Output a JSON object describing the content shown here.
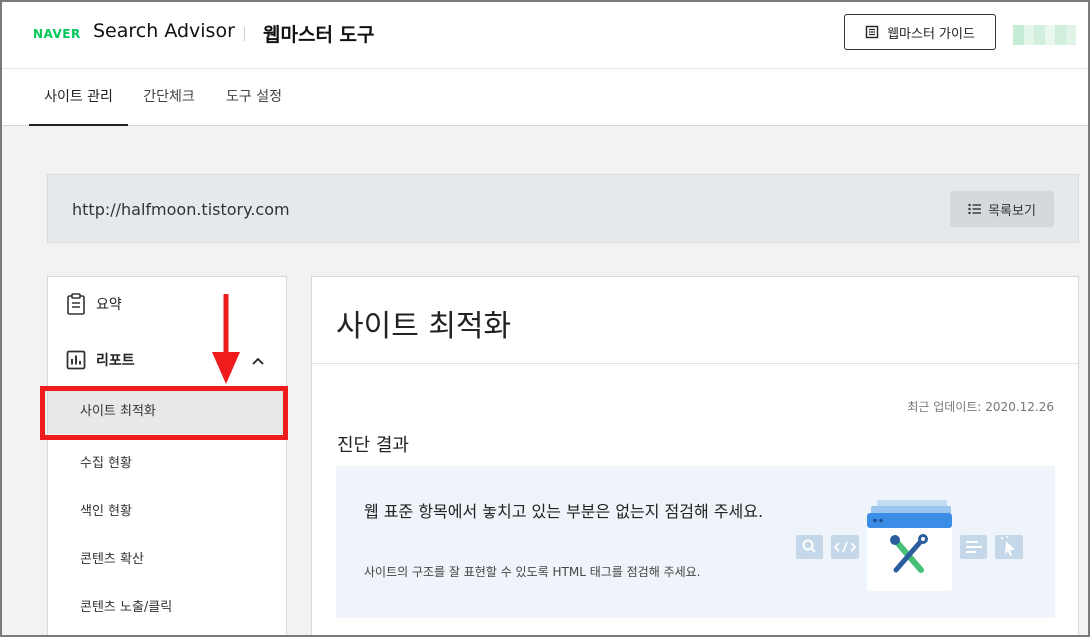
{
  "header": {
    "logo": "NAVER",
    "brand": "Search Advisor",
    "app_title": "웹마스터 도구",
    "guide_button": "웹마스터 가이드"
  },
  "tabs": [
    {
      "label": "사이트 관리",
      "active": true
    },
    {
      "label": "간단체크",
      "active": false
    },
    {
      "label": "도구 설정",
      "active": false
    }
  ],
  "site": {
    "url": "http://halfmoon.tistory.com",
    "list_button": "목록보기"
  },
  "sidebar": {
    "summary": "요약",
    "report": "리포트",
    "items": [
      {
        "label": "사이트 최적화",
        "active": true
      },
      {
        "label": "수집 현황",
        "active": false
      },
      {
        "label": "색인 현황",
        "active": false
      },
      {
        "label": "콘텐츠 확산",
        "active": false
      },
      {
        "label": "콘텐츠 노출/클릭",
        "active": false
      }
    ]
  },
  "main": {
    "title": "사이트 최적화",
    "updated": "최근 업데이트: 2020.12.26",
    "section_title": "진단 결과",
    "card_main": "웹 표준 항목에서 놓치고 있는 부분은 없는지 점검해 주세요.",
    "card_sub": "사이트의 구조를 잘 표현할 수 있도록 HTML 태그를 점검해 주세요."
  },
  "colors": {
    "naver_green": "#03c75a",
    "highlight_red": "#ee1c1c",
    "card_bg": "#eef4fa"
  },
  "icons": [
    "book-icon",
    "list-icon",
    "clipboard-icon",
    "bar-chart-icon",
    "chevron-up-icon",
    "down-arrow-annotation",
    "search-icon",
    "code-icon",
    "tools-icon",
    "text-align-icon",
    "cursor-click-icon"
  ]
}
